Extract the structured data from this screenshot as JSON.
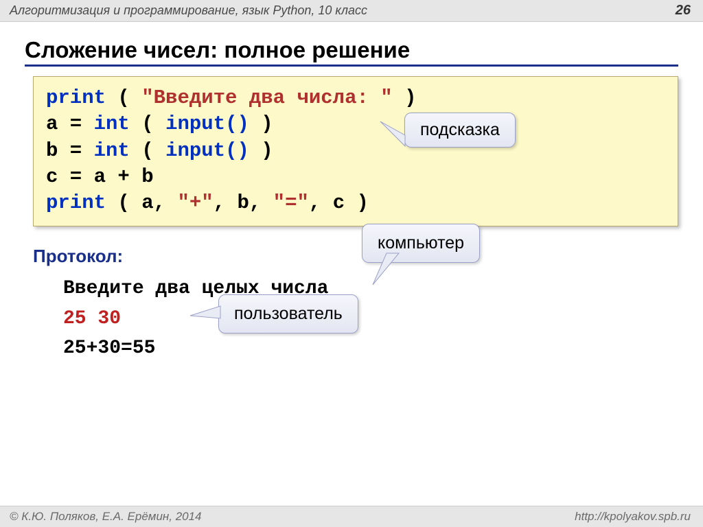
{
  "header": {
    "course": "Алгоритмизация и программирование, язык Python, 10 класс",
    "page_number": "26"
  },
  "title": "Сложение чисел: полное решение",
  "code": {
    "l1": {
      "kw": "print",
      "rest": " ( ",
      "str": "\"Введите два числа: \"",
      "end": " )"
    },
    "l2": {
      "lhs": "a = ",
      "kw": "int",
      "mid": " ( ",
      "fn": "input()",
      "end": " )"
    },
    "l3": {
      "lhs": "b = ",
      "kw": "int",
      "mid": " ( ",
      "fn": "input()",
      "end": " )"
    },
    "l4": "c = a + b",
    "l5": {
      "kw": "print",
      "open": " ( a, ",
      "s1": "\"+\"",
      "sep1": ", b, ",
      "s2": "\"=\"",
      "close": ", c )"
    }
  },
  "callouts": {
    "hint": "подсказка",
    "computer": "компьютер",
    "user": "пользователь"
  },
  "protocol": {
    "label": "Протокол:",
    "line1": "Введите два целых числа",
    "line2": "25 30",
    "line3": "25+30=55"
  },
  "footer": {
    "authors": "© К.Ю. Поляков, Е.А. Ерёмин, 2014",
    "url": "http://kpolyakov.spb.ru"
  }
}
